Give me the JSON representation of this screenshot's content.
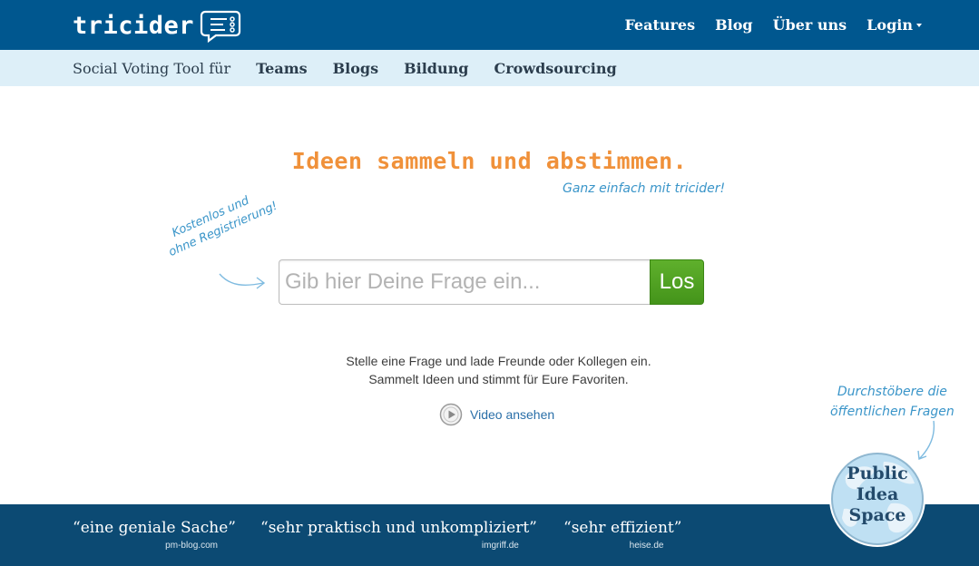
{
  "header": {
    "logo_text": "tricider",
    "nav": [
      {
        "label": "Features"
      },
      {
        "label": "Blog"
      },
      {
        "label": "Über uns"
      },
      {
        "label": "Login"
      }
    ]
  },
  "subnav": {
    "lead": "Social Voting Tool für",
    "items": [
      {
        "label": "Teams"
      },
      {
        "label": "Blogs"
      },
      {
        "label": "Bildung"
      },
      {
        "label": "Crowdsourcing"
      }
    ]
  },
  "hero": {
    "headline": "Ideen sammeln und abstimmen.",
    "subline": "Ganz einfach mit tricider!",
    "side_note_line1": "Kostenlos und",
    "side_note_line2": "ohne Registrierung!",
    "search_placeholder": "Gib hier Deine Frage ein...",
    "search_button": "Los",
    "description_line1": "Stelle eine Frage und lade Freunde oder Kollegen ein.",
    "description_line2": "Sammelt Ideen und stimmt für Eure Favoriten.",
    "video_label": "Video ansehen"
  },
  "browse_note": {
    "line1": "Durchstöbere die",
    "line2": "öffentlichen Fragen"
  },
  "globe": {
    "line1": "Public",
    "line2": "Idea",
    "line3": "Space"
  },
  "footer": {
    "quotes": [
      {
        "text": "“eine geniale Sache”",
        "source": "pm-blog.com"
      },
      {
        "text": "“sehr praktisch und unkompliziert”",
        "source": "imgriff.de"
      },
      {
        "text": "“sehr effizient”",
        "source": "heise.de"
      }
    ]
  },
  "colors": {
    "header_bg": "#00578f",
    "subnav_bg": "#ddeff8",
    "headline": "#f0913a",
    "handwriting": "#3a95c9",
    "button": "#4ea021",
    "footer_bg": "#0c4a73"
  }
}
